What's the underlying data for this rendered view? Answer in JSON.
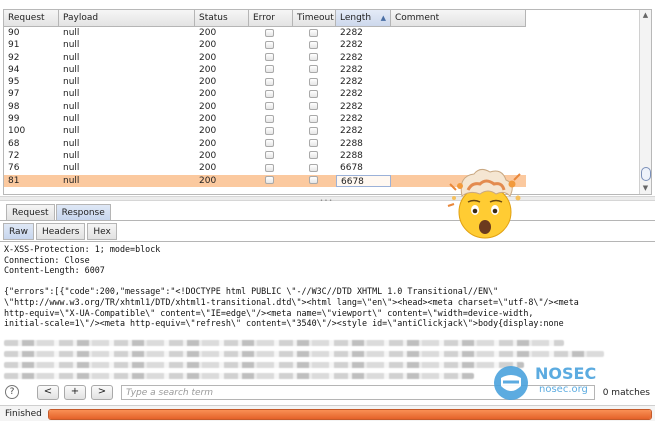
{
  "table": {
    "columns": [
      "Request",
      "Payload",
      "Status",
      "Error",
      "Timeout",
      "Length",
      "Comment"
    ],
    "sort_indicator": "▲",
    "rows": [
      {
        "request": "90",
        "payload": "null",
        "status": "200",
        "length": "2282"
      },
      {
        "request": "91",
        "payload": "null",
        "status": "200",
        "length": "2282"
      },
      {
        "request": "92",
        "payload": "null",
        "status": "200",
        "length": "2282"
      },
      {
        "request": "94",
        "payload": "null",
        "status": "200",
        "length": "2282"
      },
      {
        "request": "95",
        "payload": "null",
        "status": "200",
        "length": "2282"
      },
      {
        "request": "97",
        "payload": "null",
        "status": "200",
        "length": "2282"
      },
      {
        "request": "98",
        "payload": "null",
        "status": "200",
        "length": "2282"
      },
      {
        "request": "99",
        "payload": "null",
        "status": "200",
        "length": "2282"
      },
      {
        "request": "100",
        "payload": "null",
        "status": "200",
        "length": "2282"
      },
      {
        "request": "68",
        "payload": "null",
        "status": "200",
        "length": "2288"
      },
      {
        "request": "72",
        "payload": "null",
        "status": "200",
        "length": "2288"
      },
      {
        "request": "76",
        "payload": "null",
        "status": "200",
        "length": "6678"
      },
      {
        "request": "81",
        "payload": "null",
        "status": "200",
        "length": "6678",
        "selected": true
      }
    ]
  },
  "tabs": [
    "Request",
    "Response"
  ],
  "active_tab": "Response",
  "subtabs": [
    "Raw",
    "Headers",
    "Hex"
  ],
  "active_subtab": "Raw",
  "response": {
    "text": "X-XSS-Protection: 1; mode=block\nConnection: Close\nContent-Length: 6007\n\n{\"errors\":[{\"code\":200,\"message\":\"<!DOCTYPE html PUBLIC \\\"-//W3C//DTD XHTML 1.0 Transitional//EN\\\"\n\\\"http://www.w3.org/TR/xhtml1/DTD/xhtml1-transitional.dtd\\\"><html lang=\\\"en\\\"><head><meta charset=\\\"utf-8\\\"/><meta\nhttp-equiv=\\\"X-UA-Compatible\\\" content=\\\"IE=edge\\\"/><meta name=\\\"viewport\\\" content=\\\"width=device-width,\ninitial-scale=1\\\"/><meta http-equiv=\\\"refresh\\\" content=\\\"3540\\\"/><style id=\\\"antiClickjack\\\">body{display:none"
  },
  "search": {
    "help_label": "?",
    "prev_label": "<",
    "add_label": "+",
    "next_label": ">",
    "placeholder": "Type a search term",
    "matches": "0 matches"
  },
  "status": {
    "text": "Finished",
    "progress": 1.0
  },
  "watermark": {
    "title": "NOSEC",
    "subtitle": "nosec.org"
  },
  "colors": {
    "selected_row": "#fbc99f",
    "progress": "#e4622a",
    "watermark": "#4ba3dd"
  },
  "icons": {
    "overlay": "exploding-head-emoji",
    "watermark_logo": "shield-face-icon"
  }
}
